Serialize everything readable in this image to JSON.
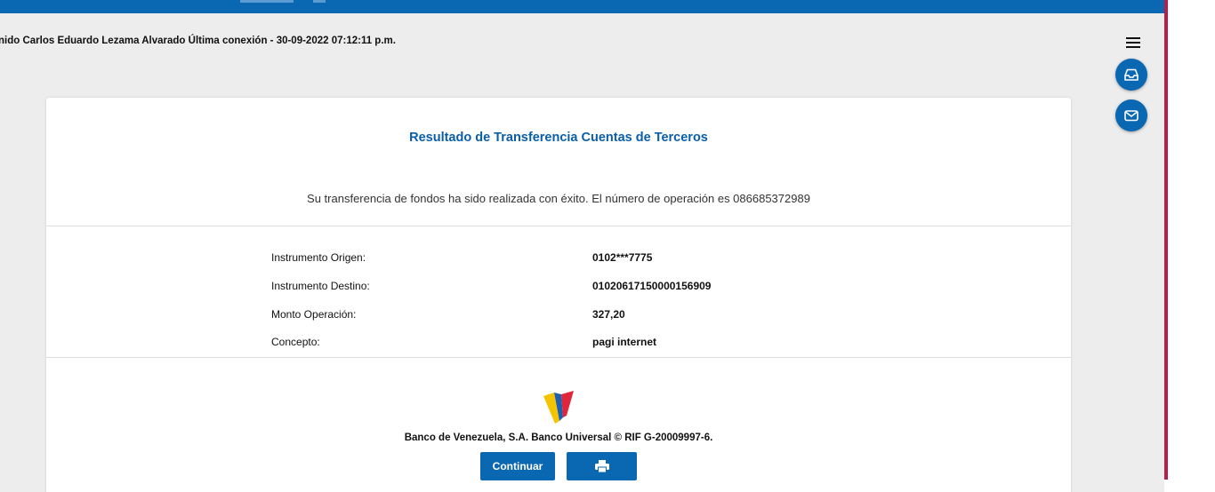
{
  "header": {
    "welcome_text": "nido Carlos Eduardo Lezama Alvarado Última conexión - 30-09-2022 07:12:11 p.m."
  },
  "icons": {
    "menu": "hamburger-menu-icon",
    "inbox": "inbox-icon",
    "mail": "mail-icon",
    "print": "printer-icon",
    "logo": "bank-logo"
  },
  "result": {
    "title": "Resultado de Transferencia Cuentas de Terceros",
    "message": "Su transferencia de fondos ha sido realizada con éxito. El número de operación es 086685372989"
  },
  "details": [
    {
      "label": "Instrumento Origen:",
      "value": "0102***7775"
    },
    {
      "label": "Instrumento Destino:",
      "value": "01020617150000156909"
    },
    {
      "label": "Monto Operación:",
      "value": "327,20"
    },
    {
      "label": "Concepto:",
      "value": "pagi internet"
    }
  ],
  "footer": {
    "legal": "Banco de Venezuela, S.A. Banco Universal © RIF G-20009997-6."
  },
  "actions": {
    "continue_label": "Continuar"
  },
  "colors": {
    "primary": "#0a67b2",
    "title": "#0a5ea8",
    "accent": "#b71c4a",
    "background": "#ededed",
    "logo_yellow": "#f5c400",
    "logo_blue": "#1d5fb0",
    "logo_red": "#e0263a"
  }
}
